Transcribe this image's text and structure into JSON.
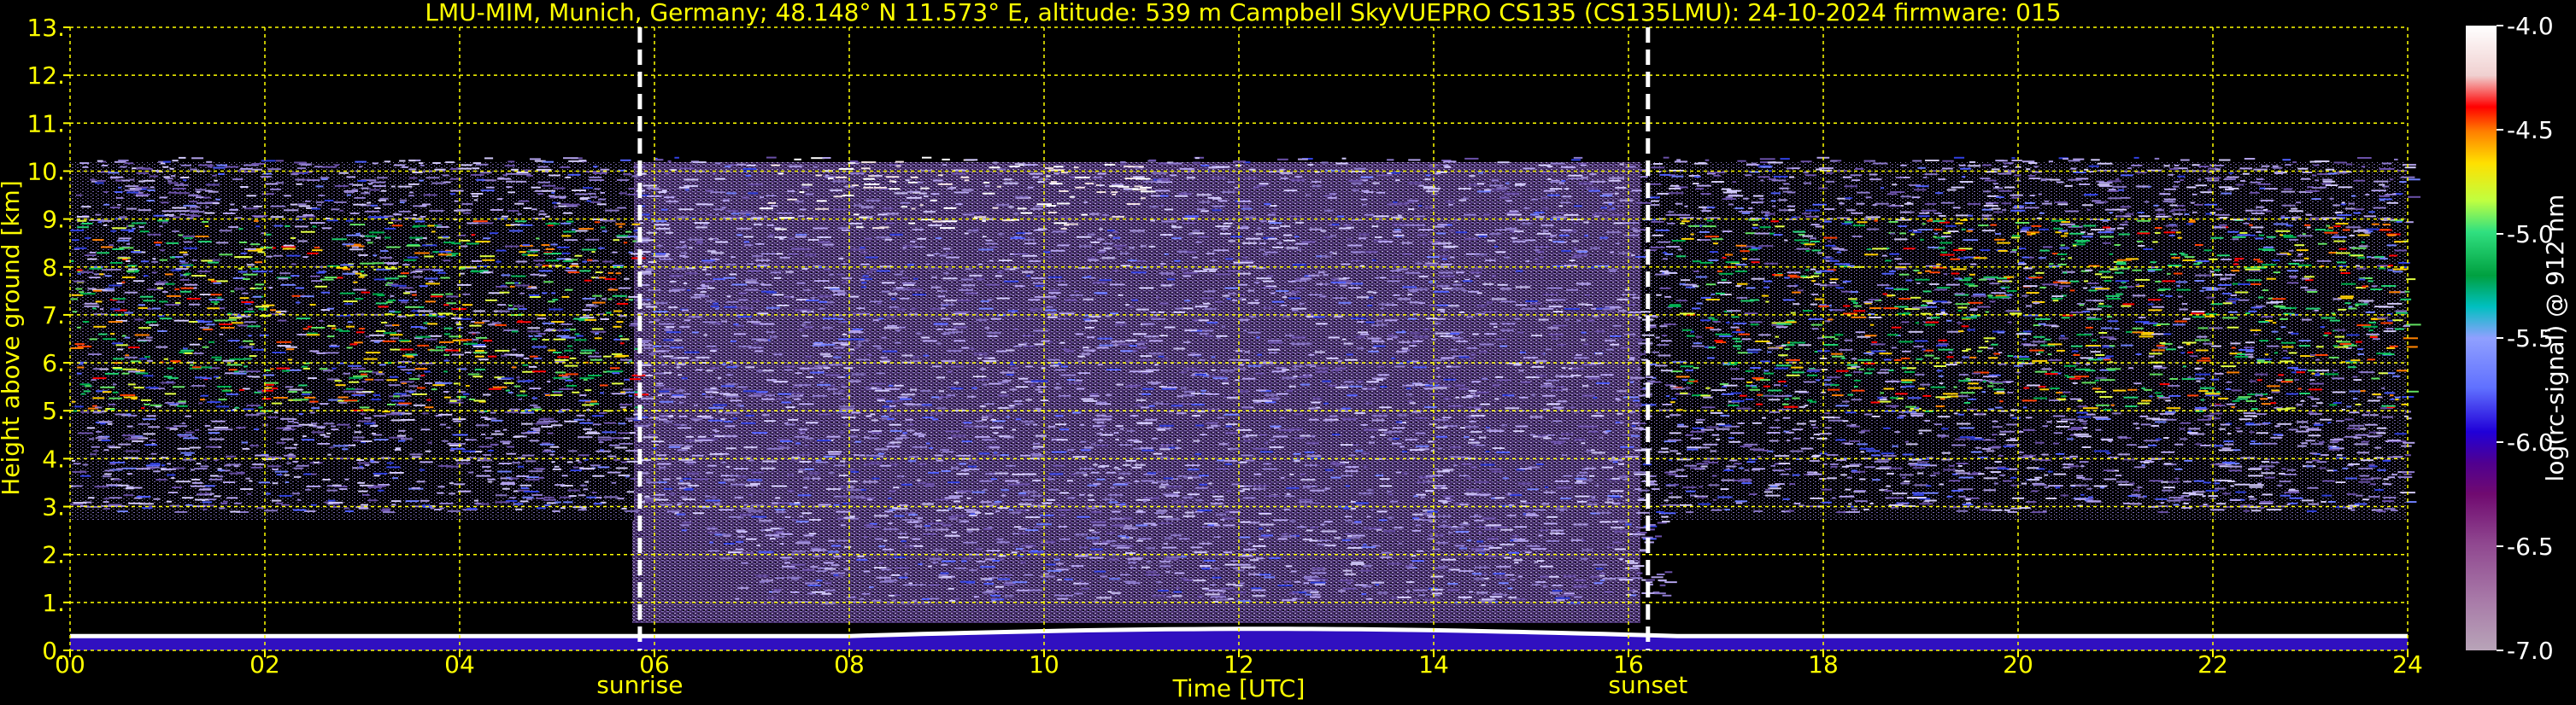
{
  "chart_data": {
    "type": "heatmap",
    "title": "LMU-MIM, Munich, Germany; 48.148° N 11.573° E, altitude: 539 m    Campbell SkyVUEPRO CS135 (CS135LMU): 24-10-2024    firmware: 015",
    "xlabel": "Time [UTC]",
    "ylabel": "Height above ground [km]",
    "xlim": [
      0,
      24
    ],
    "ylim": [
      0,
      13
    ],
    "x_ticks": [
      0,
      2,
      4,
      6,
      8,
      10,
      12,
      14,
      16,
      18,
      20,
      22,
      24
    ],
    "x_tick_labels": [
      "00",
      "02",
      "04",
      "06",
      "08",
      "10",
      "12",
      "14",
      "16",
      "18",
      "20",
      "22",
      "24"
    ],
    "y_ticks": [
      0,
      1,
      2,
      3,
      4,
      5,
      6,
      7,
      8,
      9,
      10,
      11,
      12,
      13
    ],
    "y_tick_labels": [
      "0.",
      "1.",
      "2.",
      "3.",
      "4.",
      "5.",
      "6.",
      "7.",
      "8.",
      "9.",
      "10.",
      "11.",
      "12.",
      "13."
    ],
    "grid": true,
    "events": [
      {
        "label": "sunrise",
        "time": 5.85
      },
      {
        "label": "sunset",
        "time": 16.2
      }
    ],
    "colorbar": {
      "label": "log(rc-signal) @ 912 nm",
      "range": [
        -7.0,
        -4.0
      ],
      "ticks": [
        -4.0,
        -4.5,
        -5.0,
        -5.5,
        -6.0,
        -6.5,
        -7.0
      ],
      "tick_labels": [
        "-4.0",
        "-4.5",
        "-5.0",
        "-5.5",
        "-6.0",
        "-6.5",
        "-7.0"
      ]
    },
    "features": {
      "aerosol_layer_top_km": 10.3,
      "surface_layer_top_km": 0.3,
      "boundary_layer_max_km": 0.45
    }
  }
}
